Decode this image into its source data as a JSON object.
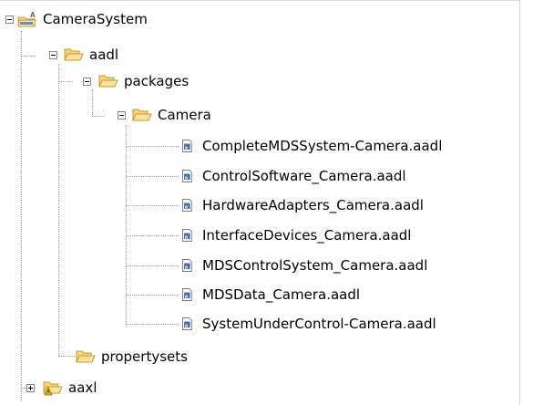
{
  "tree": {
    "root": {
      "label": "CameraSystem",
      "icon": "project-icon"
    },
    "aadl": {
      "label": "aadl",
      "icon": "folder-open-icon"
    },
    "packages": {
      "label": "packages",
      "icon": "folder-open-icon"
    },
    "camera": {
      "label": "Camera",
      "icon": "folder-open-icon"
    },
    "files": [
      {
        "label": "CompleteMDSSystem-Camera.aadl",
        "icon": "aadl-file-icon"
      },
      {
        "label": "ControlSoftware_Camera.aadl",
        "icon": "aadl-file-icon"
      },
      {
        "label": "HardwareAdapters_Camera.aadl",
        "icon": "aadl-file-icon"
      },
      {
        "label": "InterfaceDevices_Camera.aadl",
        "icon": "aadl-file-icon"
      },
      {
        "label": "MDSControlSystem_Camera.aadl",
        "icon": "aadl-file-icon"
      },
      {
        "label": "MDSData_Camera.aadl",
        "icon": "aadl-file-icon"
      },
      {
        "label": "SystemUnderControl-Camera.aadl",
        "icon": "aadl-file-icon"
      }
    ],
    "propertysets": {
      "label": "propertysets",
      "icon": "folder-open-icon"
    },
    "aaxl": {
      "label": "aaxl",
      "icon": "folder-warning-icon"
    }
  },
  "colors": {
    "folder_fill": "#f7d774",
    "folder_edge": "#c99a2e",
    "file_blue": "#3f6fb5",
    "warning": "#f0b400"
  }
}
